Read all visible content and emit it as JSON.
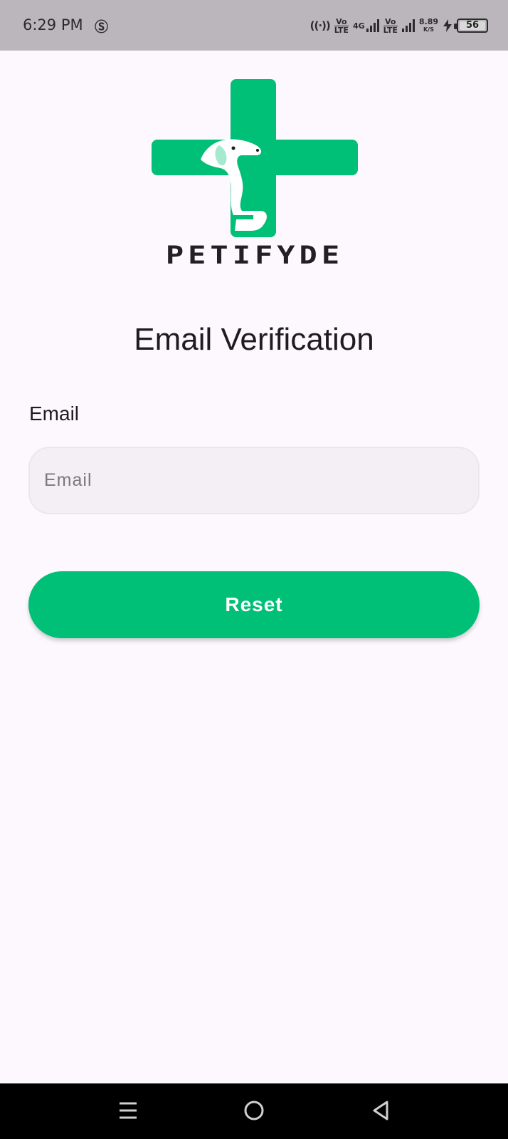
{
  "status_bar": {
    "time": "6:29 PM",
    "notification_icon": "s-icon",
    "sim1_label_top": "Vo",
    "sim1_label_bottom": "LTE",
    "network_type": "4G",
    "sim2_label_top": "Vo",
    "sim2_label_bottom": "LTE",
    "speed_value": "8.89",
    "speed_unit": "K/S",
    "battery_level": "56"
  },
  "logo": {
    "brand_name": "PETIFYDE",
    "accent_color": "#00bf76"
  },
  "page": {
    "title": "Email Verification"
  },
  "form": {
    "email_label": "Email",
    "email_placeholder": "Email",
    "email_value": "",
    "reset_label": "Reset"
  },
  "colors": {
    "background": "#fdf7fe",
    "primary": "#00bf76",
    "input_bg": "#f3eff4",
    "status_bar_bg": "#bbb6bb"
  },
  "nav_bar": {
    "icons": [
      "menu-icon",
      "home-circle-icon",
      "back-triangle-icon"
    ]
  }
}
